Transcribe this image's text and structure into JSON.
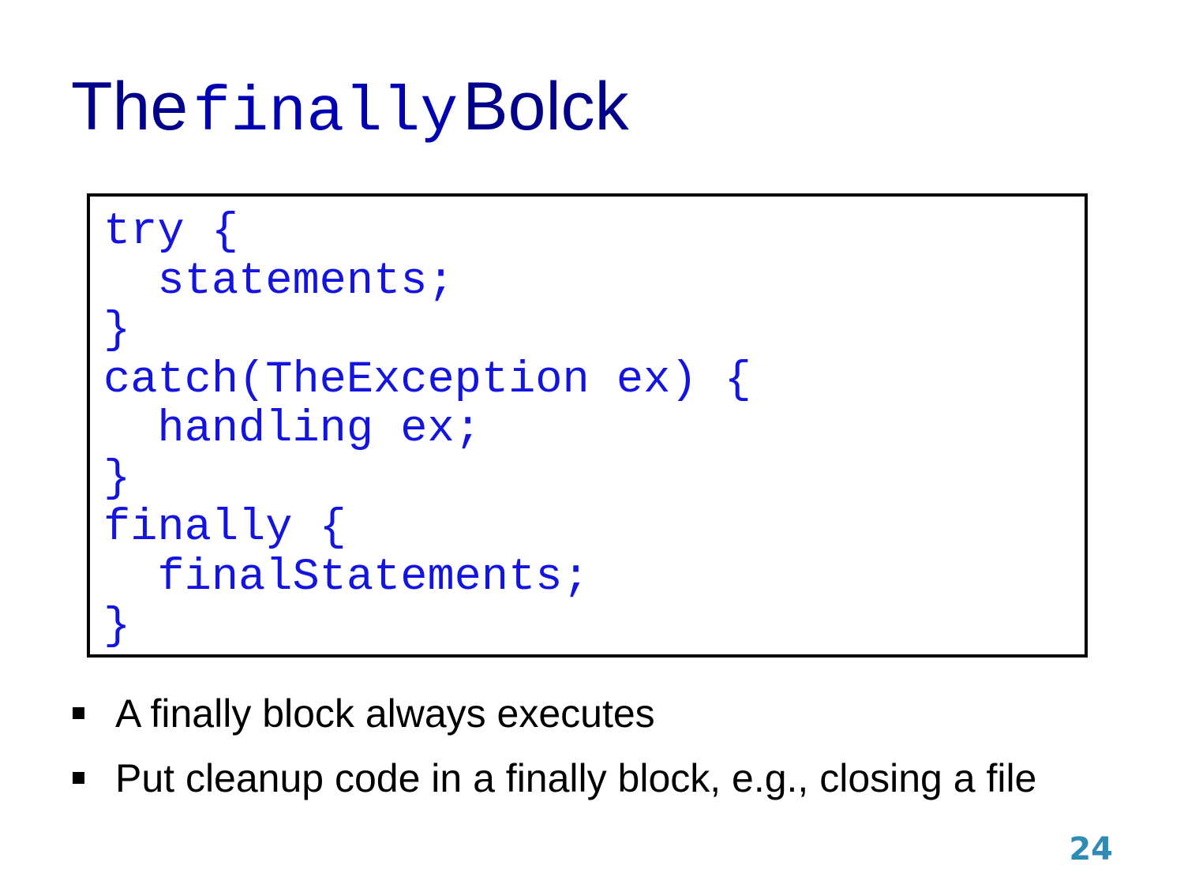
{
  "slide": {
    "title": {
      "prefix": "The",
      "code_word": "finally",
      "suffix": "Bolck"
    },
    "code_block": {
      "lines": [
        "try {",
        "  statements;",
        "}",
        "catch(TheException ex) {",
        "  handling ex;",
        "}",
        "finally {",
        "  finalStatements;",
        "}"
      ]
    },
    "bullets": [
      "A finally block always executes",
      "Put cleanup code in a finally block, e.g., closing a file"
    ],
    "page_number": "24"
  },
  "colors": {
    "title": "#00008b",
    "code_text": "#1414e0",
    "code_border": "#000000",
    "bullet_text": "#000000",
    "page_number": "#2e8bb5"
  }
}
